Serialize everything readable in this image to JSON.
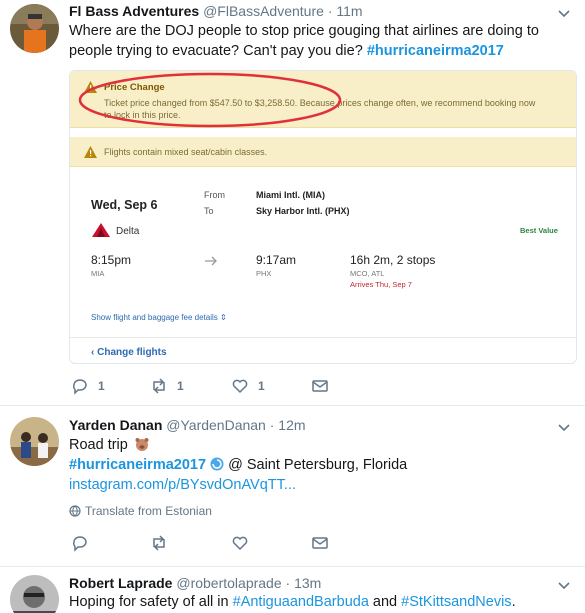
{
  "tweets": [
    {
      "name": "Fl Bass Adventures",
      "handle": "@FlBassAdventure",
      "time": "· 11m",
      "text_plain": "Where are the DOJ people to stop price gouging that airlines are doing to people trying to evacuate? Can't pay you die? ",
      "hashtag": "#hurricaneirma2017",
      "card": {
        "banner1_title": "Price Change",
        "banner1_msg": "Ticket price changed from $547.50 to $3,258.50. Because prices change often, we recommend booking now to lock in this price.",
        "banner2_msg": "Flights contain mixed seat/cabin classes.",
        "date": "Wed, Sep 6",
        "from_label": "From",
        "to_label": "To",
        "from_airport": "Miami Intl. (MIA)",
        "to_airport": "Sky Harbor Intl. (PHX)",
        "airline": "Delta",
        "best_value": "Best Value",
        "depart_time": "8:15pm",
        "depart_code": "MIA",
        "arrive_time": "9:17am",
        "arrive_code": "PHX",
        "duration": "16h 2m, 2 stops",
        "stops": "MCO, ATL",
        "arrives_note": "Arrives Thu, Sep 7",
        "details_link": "Show flight and baggage fee details ⇕",
        "change_flights": "‹ Change flights"
      },
      "replies": "1",
      "retweets": "1",
      "likes": "1"
    },
    {
      "name": "Yarden Danan",
      "handle": "@YardenDanan",
      "time": "· 12m",
      "line1": "Road trip",
      "hashtag": "#hurricaneirma2017",
      "location": " @ Saint Petersburg, Florida",
      "link": "instagram.com/p/BYsvdOnAVqTT...",
      "translate": "Translate from Estonian"
    },
    {
      "name": "Robert Laprade",
      "handle": "@robertolaprade",
      "time": "· 13m",
      "text_start": "Hoping for safety of all in ",
      "hashtag1": "#AntiguaandBarbuda",
      "and_text": " and ",
      "hashtag2": "#StKittsandNevis",
      "end": "."
    }
  ],
  "colors": {
    "accent": "#1b95e0",
    "muted": "#657786",
    "banner": "#f8efc8",
    "oval": "#e0313a",
    "delta_red": "#c8102e",
    "best_value": "#2e8540"
  }
}
